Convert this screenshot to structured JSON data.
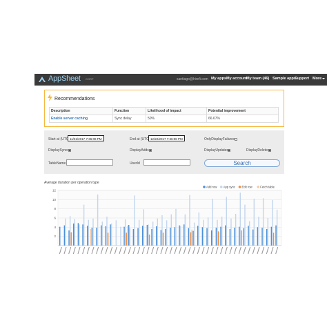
{
  "nav": {
    "brand": "AppSheet",
    "corp": "CORP",
    "user_email": "santiago@hirefi.com",
    "links": [
      "My apps",
      "My account",
      "My team (46)",
      "Sample apps",
      "Support",
      "More"
    ],
    "bg_color": "#3a3a3a"
  },
  "recommendations": {
    "title": "Recommendations",
    "headers": [
      "Description",
      "Function",
      "Likelihood of impact",
      "Potential improvement"
    ],
    "row": [
      "Enable server caching",
      "Sync delay",
      "50%",
      "66.67%"
    ],
    "border_color": "#f5b942",
    "icon": "lightning-icon"
  },
  "filters": {
    "start_label": "Start at (UTC)",
    "start_value": "11/01/2017 7:36:08 PM",
    "end_label": "End at (UTC)",
    "end_value": "12/22/2017 7:36:08 PM",
    "only_failures_label": "OnlyDisplayFailures",
    "display_syncs_label": "DisplaySyncs",
    "display_adds_label": "DisplayAdds",
    "display_updates_label": "DisplayUpdates",
    "display_deletes_label": "DisplayDeletes",
    "tablename_label": "TableName",
    "userid_label": "UserId",
    "tablename_value": "",
    "userid_value": "",
    "search_label": "Search"
  },
  "chart_data": {
    "type": "bar",
    "title": "Average duration per operation type",
    "ylim": [
      0,
      12
    ],
    "yticks": [
      2,
      4,
      6,
      8,
      10,
      12
    ],
    "series": [
      {
        "name": "Add row",
        "color": "#4a8fd8"
      },
      {
        "name": "App sync",
        "color": "#c3d6ee"
      },
      {
        "name": "Edit row",
        "color": "#f08c3c"
      },
      {
        "name": "Fetch table",
        "color": "#f5c9a6"
      }
    ],
    "values": [
      [
        4.1,
        0,
        0,
        0
      ],
      [
        4.4,
        5.9,
        0,
        0
      ],
      [
        3.3,
        6.4,
        2.9,
        0
      ],
      [
        4.8,
        5.8,
        0,
        0
      ],
      [
        4.9,
        4.6,
        0,
        0
      ],
      [
        4.6,
        8.9,
        0,
        0
      ],
      [
        4.3,
        5.6,
        0,
        3.6
      ],
      [
        3.9,
        5.9,
        0,
        0
      ],
      [
        3.9,
        11.1,
        0,
        0
      ],
      [
        4.4,
        5.2,
        0,
        0
      ],
      [
        4.2,
        6.3,
        2.8,
        0
      ],
      [
        4.6,
        4.8,
        0,
        0
      ],
      [
        0,
        5.5,
        0,
        0
      ],
      [
        0,
        4.1,
        0,
        0
      ],
      [
        4.1,
        5.7,
        2.8,
        4.3
      ],
      [
        4.5,
        3.8,
        0,
        0
      ],
      [
        3.6,
        10.9,
        0,
        0
      ],
      [
        3.8,
        5.6,
        0,
        0
      ],
      [
        4.3,
        7.9,
        0,
        0
      ],
      [
        4.5,
        4.6,
        2.4,
        0
      ],
      [
        3.6,
        5.2,
        0,
        0
      ],
      [
        4.2,
        5.9,
        0,
        0
      ],
      [
        3.4,
        6.6,
        2.8,
        0
      ],
      [
        3.6,
        5.5,
        0,
        0
      ],
      [
        3.9,
        6.8,
        0,
        0
      ],
      [
        4.0,
        8.0,
        0,
        0
      ],
      [
        4.4,
        4.3,
        0,
        0
      ],
      [
        4.6,
        6.8,
        0,
        0
      ],
      [
        3.8,
        11.0,
        2.9,
        3.5
      ],
      [
        3.2,
        5.0,
        0,
        0
      ],
      [
        4.3,
        7.2,
        0,
        0
      ],
      [
        4.0,
        5.6,
        0,
        0
      ],
      [
        3.8,
        6.1,
        0,
        0
      ],
      [
        3.3,
        10.2,
        0,
        0
      ],
      [
        3.9,
        5.6,
        3.1,
        0
      ],
      [
        4.1,
        6.3,
        0,
        0
      ],
      [
        4.4,
        10.6,
        0,
        0
      ],
      [
        3.6,
        5.9,
        0,
        0
      ],
      [
        3.9,
        6.9,
        0,
        0
      ],
      [
        4.1,
        11.5,
        3.3,
        0
      ],
      [
        3.8,
        8.9,
        0,
        0
      ],
      [
        4.3,
        5.3,
        0,
        0
      ],
      [
        3.5,
        10.2,
        0,
        0
      ],
      [
        4.0,
        6.3,
        0,
        0
      ],
      [
        3.9,
        10.3,
        0,
        0
      ],
      [
        3.6,
        6.0,
        0,
        0
      ],
      [
        4.1,
        9.9,
        2.8,
        0
      ],
      [
        4.4,
        7.8,
        0,
        0
      ]
    ]
  }
}
